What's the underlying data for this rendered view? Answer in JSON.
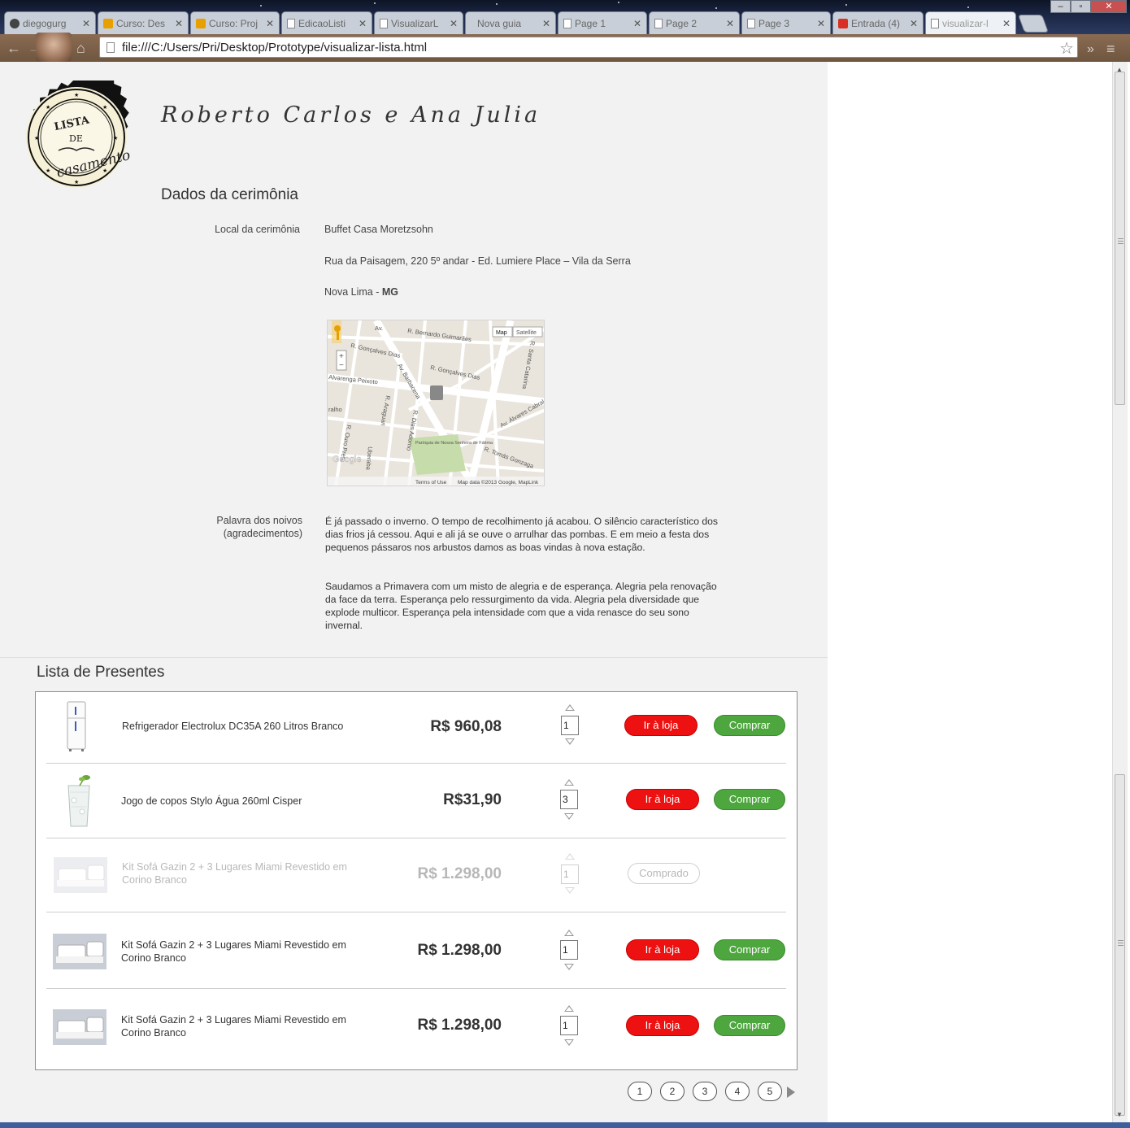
{
  "browser": {
    "tabs": [
      {
        "label": "diegogurg",
        "icon": "github-icon"
      },
      {
        "label": "Curso: Des",
        "icon": "cursos-icon"
      },
      {
        "label": "Curso: Proj",
        "icon": "cursos-icon"
      },
      {
        "label": "EdicaoListi",
        "icon": "page-icon"
      },
      {
        "label": "VisualizarL",
        "icon": "page-icon"
      },
      {
        "label": "Nova guia",
        "icon": ""
      },
      {
        "label": "Page 1",
        "icon": "page-icon"
      },
      {
        "label": "Page 2",
        "icon": "page-icon"
      },
      {
        "label": "Page 3",
        "icon": "page-icon"
      },
      {
        "label": "Entrada (4)",
        "icon": "gmail-icon"
      },
      {
        "label": "visualizar-l",
        "icon": "page-icon"
      }
    ],
    "active_tab_index": 10,
    "url": "file:///C:/Users/Pri/Desktop/Prototype/visualizar-lista.html"
  },
  "page": {
    "logo": {
      "top": "LISTA",
      "middle": "DE",
      "bottom": "casamento"
    },
    "couple_title": "Roberto Carlos e Ana Julia",
    "ceremony": {
      "heading": "Dados da cerimônia",
      "location_label": "Local da cerimônia",
      "venue": "Buffet Casa Moretzsohn",
      "address": "Rua da Paisagem, 220 5º andar - Ed. Lumiere Place – Vila da Serra",
      "city": "Nova Lima - ",
      "state": "MG",
      "map": {
        "map_btn": "Map",
        "satellite_btn": "Satellite",
        "terms": "Terms of Use",
        "data": "Map data ©2013 Google, MapLink",
        "google": "Google",
        "streets": [
          "Av. ",
          "R. Bernardo Guimarães",
          "R. Gonçalves Dias",
          "R. Gonçalves Dias",
          "Alvarenga Peixoto",
          "Av. Barbacena",
          "R. Santa Catarina",
          "R. Araguari",
          "R. Ouro Preto",
          "Av. Álvares Cabral",
          "R. Tomás Gonzaga",
          "Paróquia de Nossa Senhora de Fátima",
          "R. Dias Adorno",
          "ralho",
          "Uberaba"
        ]
      },
      "message_label_1": "Palavra dos noivos",
      "message_label_2": "(agradecimentos)",
      "message_p1": "É já passado o inverno. O tempo de recolhimento já acabou. O silêncio característico dos dias frios já cessou. Aqui e ali já se ouve o arrulhar das pombas. E em meio a festa dos pequenos pássaros nos arbustos damos as boas vindas à nova estação.",
      "message_p2": "Saudamos a Primavera com um misto de alegria e de esperança. Alegria pela renovação da face da terra. Esperança pelo ressurgimento da vida. Alegria pela diversidade que explode multicor. Esperança pela intensidade com que a vida renasce do seu sono invernal."
    },
    "gifts": {
      "heading": "Lista de Presentes",
      "store_label": "Ir à loja",
      "buy_label": "Comprar",
      "bought_label": "Comprado",
      "items": [
        {
          "name": "Refrigerador Electrolux DC35A 260 Litros Branco",
          "price": "R$ 960,08",
          "qty": "1",
          "status": "available"
        },
        {
          "name": "Jogo de copos Stylo Água 260ml Cisper",
          "price": "R$31,90",
          "qty": "3",
          "status": "available"
        },
        {
          "name": "Kit Sofá Gazin 2 + 3 Lugares Miami Revestido em Corino Branco",
          "price": "R$ 1.298,00",
          "qty": "1",
          "status": "bought"
        },
        {
          "name": "Kit Sofá Gazin 2 + 3 Lugares Miami Revestido em Corino Branco",
          "price": "R$ 1.298,00",
          "qty": "1",
          "status": "available"
        },
        {
          "name": "Kit Sofá Gazin 2 + 3 Lugares Miami Revestido em Corino Branco",
          "price": "R$ 1.298,00",
          "qty": "1",
          "status": "available"
        }
      ]
    },
    "pagination": [
      "1",
      "2",
      "3",
      "4",
      "5"
    ]
  }
}
